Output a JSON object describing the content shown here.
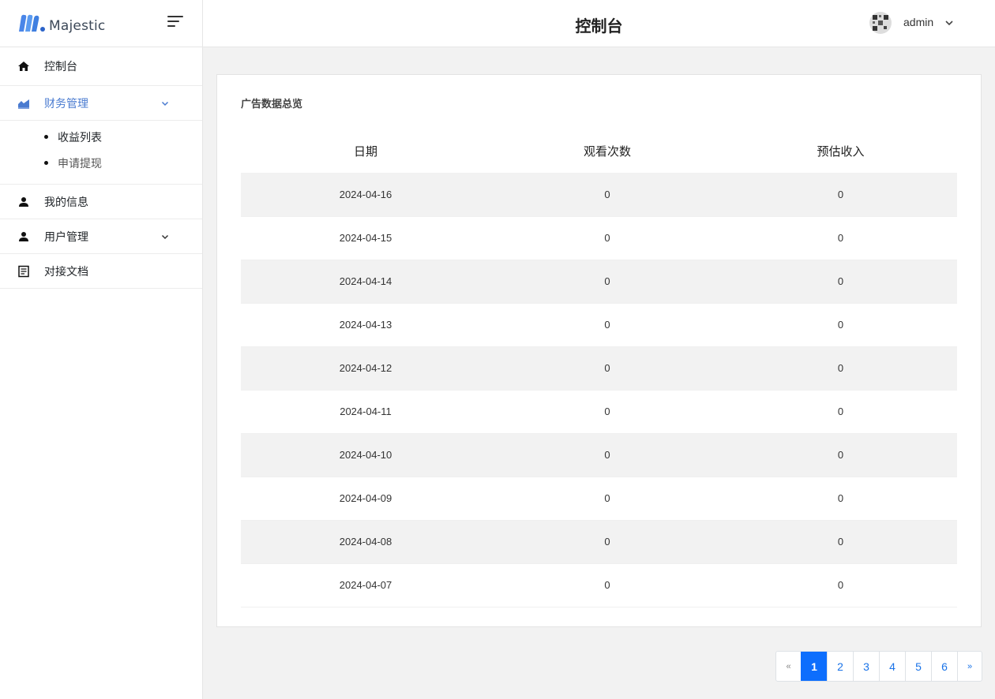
{
  "brand": {
    "name": "Majestic"
  },
  "header": {
    "title": "控制台",
    "user_name": "admin"
  },
  "sidebar": {
    "items": [
      {
        "label": "控制台",
        "icon": "home-icon"
      },
      {
        "label": "财务管理",
        "icon": "chart-area-icon",
        "active": true,
        "children": [
          {
            "label": "收益列表"
          },
          {
            "label": "申请提现"
          }
        ]
      },
      {
        "label": "我的信息",
        "icon": "person-icon"
      },
      {
        "label": "用户管理",
        "icon": "person-icon"
      },
      {
        "label": "对接文档",
        "icon": "document-icon"
      }
    ]
  },
  "card": {
    "title": "广告数据总览"
  },
  "table": {
    "headers": [
      "日期",
      "观看次数",
      "预估收入"
    ],
    "rows": [
      [
        "2024-04-16",
        "0",
        "0"
      ],
      [
        "2024-04-15",
        "0",
        "0"
      ],
      [
        "2024-04-14",
        "0",
        "0"
      ],
      [
        "2024-04-13",
        "0",
        "0"
      ],
      [
        "2024-04-12",
        "0",
        "0"
      ],
      [
        "2024-04-11",
        "0",
        "0"
      ],
      [
        "2024-04-10",
        "0",
        "0"
      ],
      [
        "2024-04-09",
        "0",
        "0"
      ],
      [
        "2024-04-08",
        "0",
        "0"
      ],
      [
        "2024-04-07",
        "0",
        "0"
      ]
    ]
  },
  "pagination": {
    "prev": "«",
    "next": "»",
    "pages": [
      "1",
      "2",
      "3",
      "4",
      "5",
      "6"
    ],
    "current": "1"
  },
  "colors": {
    "accent": "#4a7bd0",
    "pager_active": "#0d6efd",
    "stripe": "#f2f2f2"
  }
}
